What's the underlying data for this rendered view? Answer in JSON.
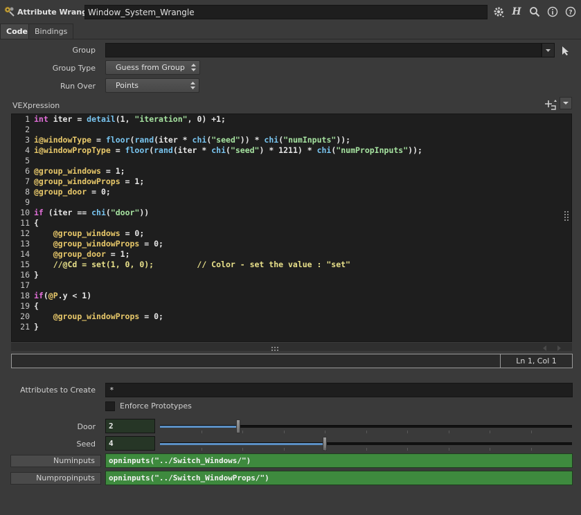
{
  "header": {
    "node_type": "Attribute Wrangle",
    "node_name": "Window_System_Wrangle",
    "icons": [
      "gear-icon",
      "houdini-help-icon",
      "search-icon",
      "info-icon",
      "help-icon"
    ]
  },
  "tabs": [
    {
      "label": "Code",
      "active": true
    },
    {
      "label": "Bindings",
      "active": false
    }
  ],
  "params": {
    "group_label": "Group",
    "group_value": "",
    "group_type_label": "Group Type",
    "group_type_value": "Guess from Group",
    "run_over_label": "Run Over",
    "run_over_value": "Points",
    "vexpression_label": "VEXpression"
  },
  "code": {
    "line_numbers": [
      "1",
      "2",
      "3",
      "4",
      "5",
      "6",
      "7",
      "8",
      "9",
      "10",
      "11",
      "12",
      "13",
      "14",
      "15",
      "16",
      "17",
      "18",
      "19",
      "20",
      "21"
    ]
  },
  "status": {
    "position": "Ln 1, Col 1"
  },
  "attributes": {
    "label": "Attributes to Create",
    "value": "*",
    "enforce_label": "Enforce Prototypes",
    "enforce_checked": false
  },
  "door": {
    "label": "Door",
    "value": "2",
    "slider_fraction": 0.19
  },
  "seed": {
    "label": "Seed",
    "value": "4",
    "slider_fraction": 0.4
  },
  "spare": [
    {
      "label": "Numinputs",
      "value": "opninputs(\"../Switch_Windows/\")"
    },
    {
      "label": "Numpropinputs",
      "value": "opninputs(\"../Switch_WindowProps/\")"
    }
  ],
  "colors": {
    "keyword": "#e26fd9",
    "function": "#79c5f0",
    "string": "#a6e3a0",
    "attribute": "#e8c86a",
    "expression_bg": "#3e8a3e",
    "slider_fill": "#5b8fc4"
  }
}
